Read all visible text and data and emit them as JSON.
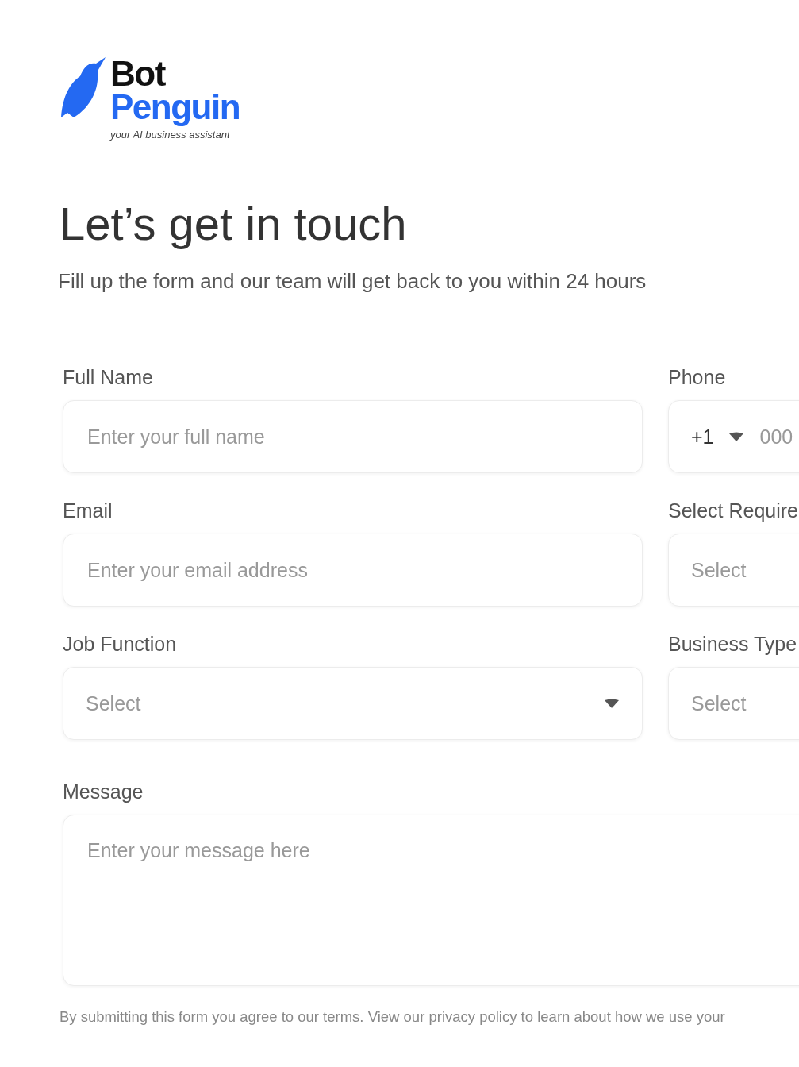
{
  "logo": {
    "line_1": "Bot",
    "line_2": "Penguin",
    "tagline": "your AI business assistant"
  },
  "heading": "Let’s get in touch",
  "subtitle": "Fill up the form and our team will get back to you within 24 hours",
  "fields": [
    {
      "kind": "text",
      "label": "Full Name",
      "placeholder": "Enter your full name"
    },
    {
      "kind": "phone",
      "label": "Phone",
      "code": "+1",
      "placeholder": "000"
    },
    {
      "kind": "text",
      "label": "Email",
      "placeholder": "Enter your email address"
    },
    {
      "kind": "select",
      "label": "Select Require",
      "placeholder": "Select"
    },
    {
      "kind": "select",
      "label": "Job Function",
      "placeholder": "Select",
      "caret": true
    },
    {
      "kind": "select",
      "label": "Business Type",
      "placeholder": "Select"
    },
    {
      "kind": "textarea",
      "label": "Message",
      "placeholder": "Enter your message here"
    }
  ],
  "consent": {
    "before": "By submitting this form you agree to our terms. View our ",
    "link": "privacy policy",
    "after": " to learn about how we use your"
  }
}
